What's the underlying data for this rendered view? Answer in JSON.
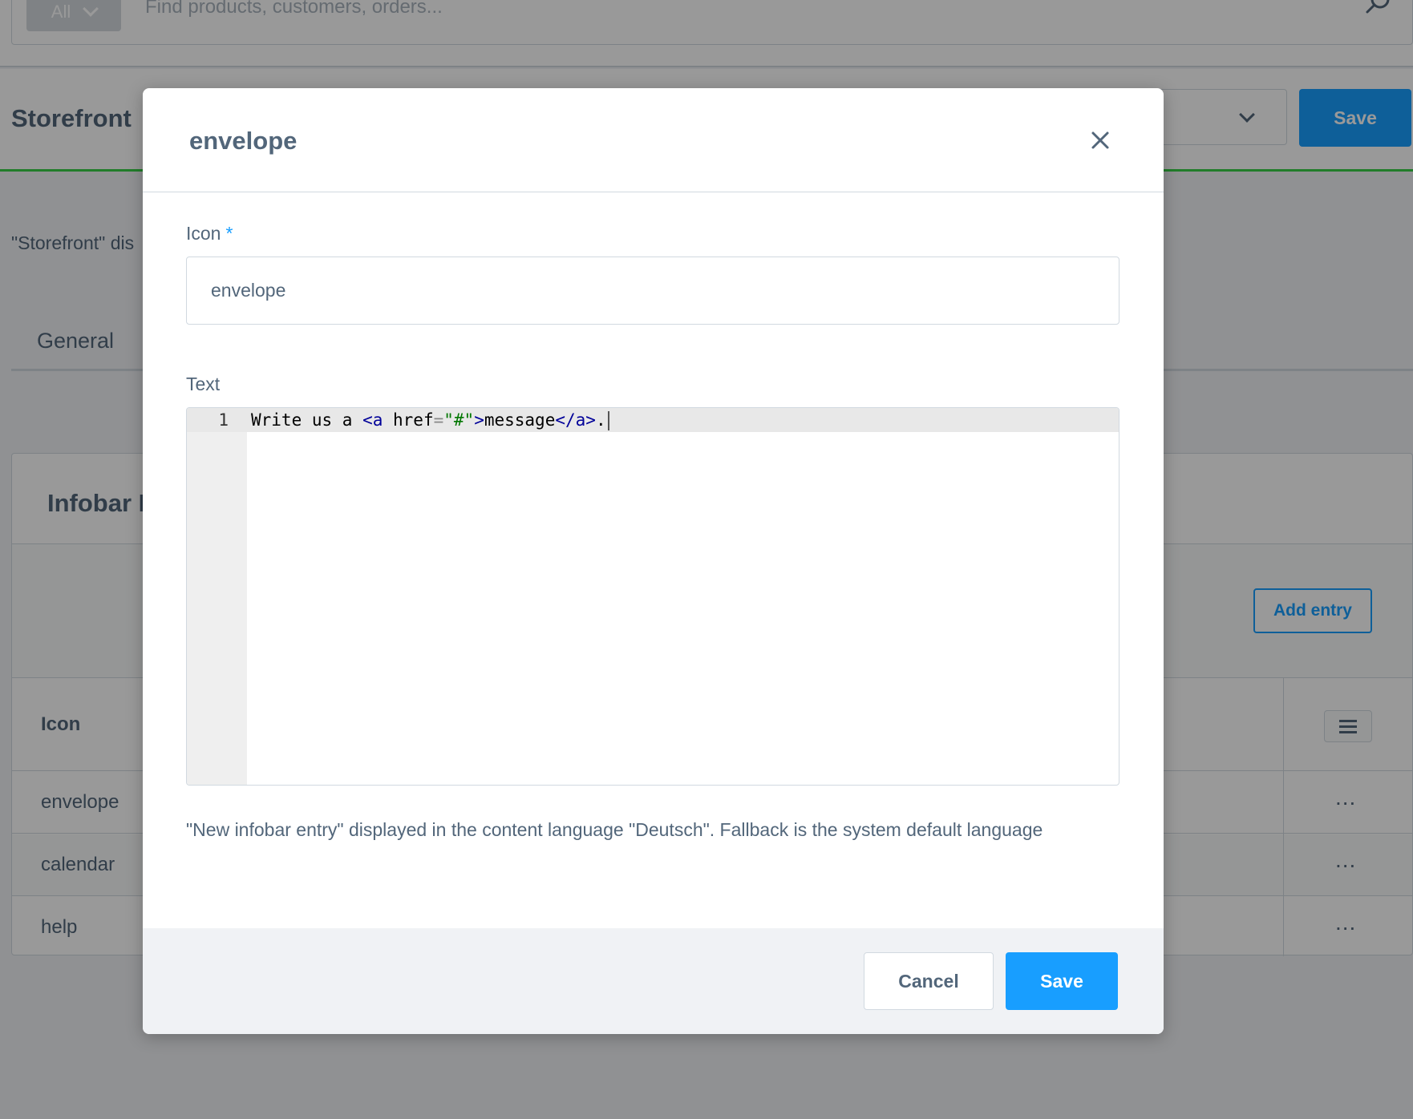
{
  "search": {
    "type_label": "All",
    "placeholder": "Find products, customers, orders..."
  },
  "header": {
    "title": "Storefront",
    "save_label": "Save"
  },
  "page": {
    "description": "\"Storefront\" dis",
    "tab_general": "General"
  },
  "card": {
    "title": "Infobar E",
    "add_entry_label": "Add entry",
    "column_icon": "Icon",
    "rows": [
      {
        "icon": "envelope",
        "actions": "..."
      },
      {
        "icon": "calendar",
        "actions": "..."
      },
      {
        "icon": "help",
        "actions": "..."
      }
    ]
  },
  "modal": {
    "title": "envelope",
    "icon_label": "Icon",
    "required_mark": "*",
    "icon_value": "envelope",
    "text_label": "Text",
    "editor": {
      "line_number": "1",
      "tokens": {
        "t1": "Write us a ",
        "t2": "<a",
        "t3": " href",
        "t4": "=",
        "t5": "\"#\"",
        "t6": ">",
        "t7": "message",
        "t8": "</a>",
        "t9": "."
      }
    },
    "help_text": "\"New infobar entry\" displayed in the content language \"Deutsch\". Fallback is the system default language",
    "cancel_label": "Cancel",
    "save_label": "Save"
  },
  "colors": {
    "accent": "#189eff",
    "text": "#52667a",
    "border": "#d1d9e0",
    "header_accent": "#37d046"
  }
}
